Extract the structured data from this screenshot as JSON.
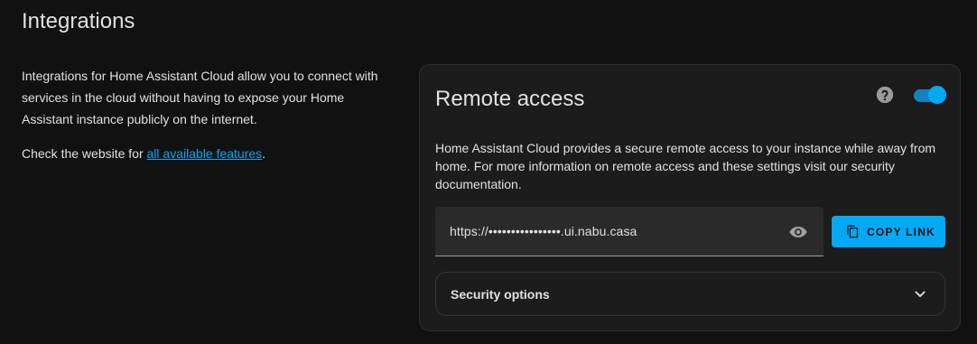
{
  "section": {
    "title": "Integrations"
  },
  "intro": {
    "paragraph1": "Integrations for Home Assistant Cloud allow you to connect with services in the cloud without having to expose your Home Assistant instance publicly on the internet.",
    "paragraph2_prefix": "Check the website for ",
    "paragraph2_link": "all available features",
    "paragraph2_suffix": "."
  },
  "remote_access": {
    "title": "Remote access",
    "help_icon": "help-circle-icon",
    "toggle_enabled": true,
    "description": "Home Assistant Cloud provides a secure remote access to your instance while away from home. For more information on remote access and these settings visit our security documentation.",
    "url_value": "https://••••••••••••••••.ui.nabu.casa",
    "eye_icon": "eye-icon",
    "copy_button_label": "COPY LINK",
    "copy_icon": "copy-icon",
    "security_options_label": "Security options",
    "chevron_icon": "chevron-down-icon"
  },
  "colors": {
    "background": "#111111",
    "card": "#1c1c1c",
    "accent": "#03a9f4",
    "text": "#e1e1e1"
  }
}
